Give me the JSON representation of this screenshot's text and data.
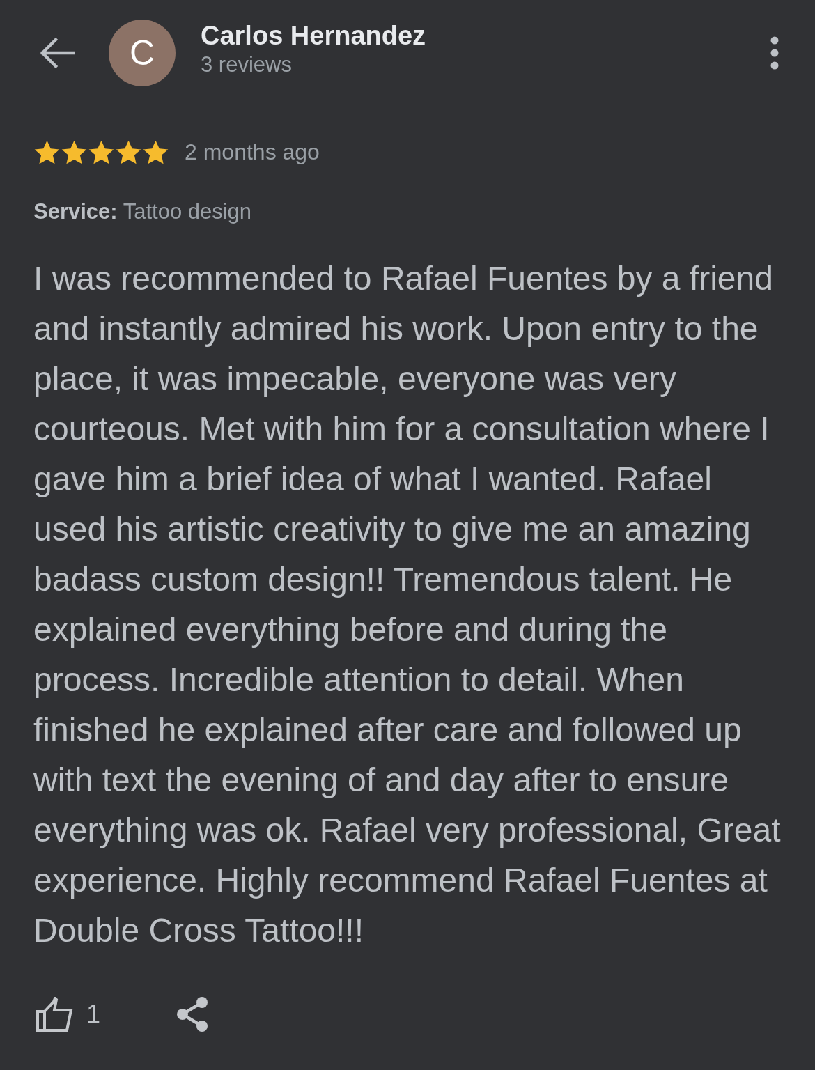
{
  "reviewer": {
    "initial": "C",
    "name": "Carlos Hernandez",
    "review_count": "3 reviews"
  },
  "review": {
    "stars": 5,
    "time": "2 months ago",
    "service": "**Service:** Tattoo design",
    "text": "I was recommended to Rafael Fuentes by a friend and instantly admired his work. Upon entry to the place, it was impecable, everyone was very courteous. Met with him for a consultation where I gave him a brief idea of what I wanted. Rafael used his artistic creativity to give me an amazing badass custom design!! Tremendous talent. He explained everything before and during the process. Incredible attention to detail. When finished he explained after care and followed up with text the evening of and day after to ensure everything was ok. Rafael very professional, Great experience. Highly recommend Rafael Fuentes at Double Cross Tattoo!!!"
  },
  "actions": {
    "like_count": "1"
  }
}
